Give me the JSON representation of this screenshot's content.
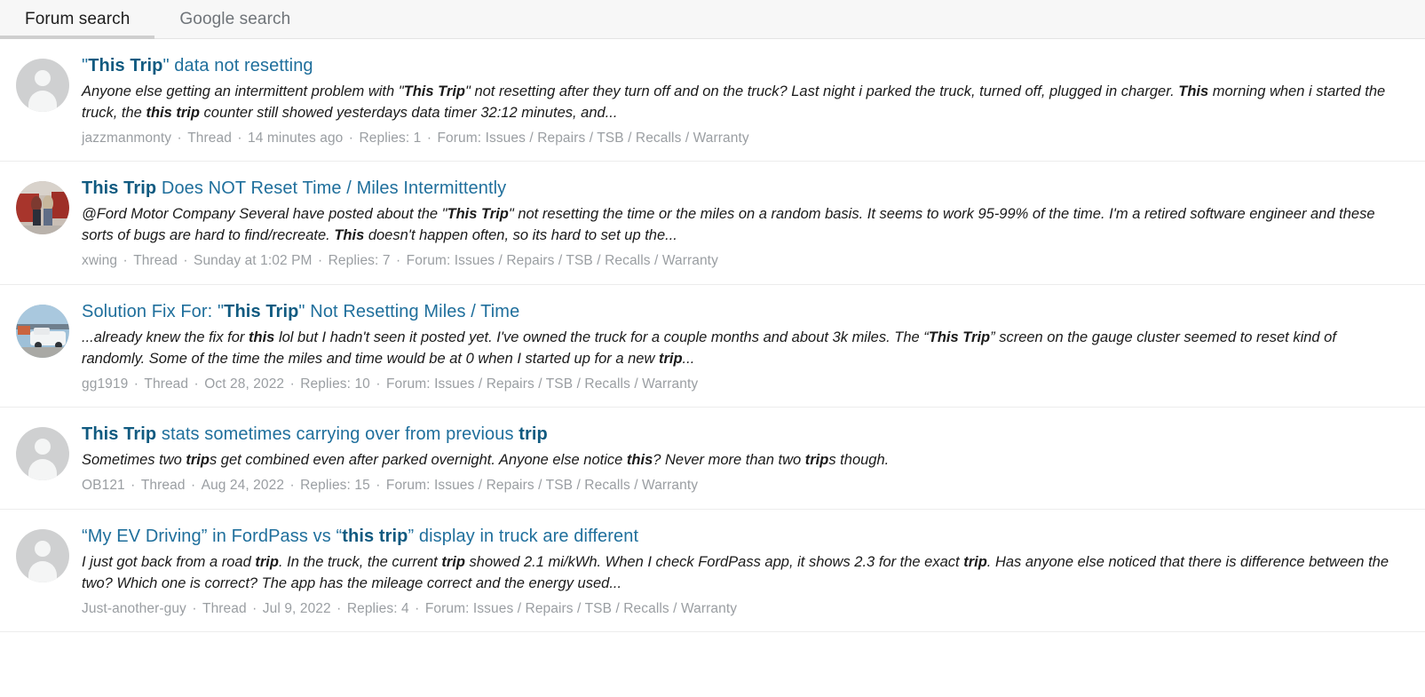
{
  "topbar": {
    "scrollbar": "vertical-scrollbar-thumb"
  },
  "tabs": [
    {
      "label": "Forum search",
      "active": true
    },
    {
      "label": "Google search",
      "active": false
    }
  ],
  "results": [
    {
      "avatar": "default-avatar-icon",
      "title_parts": [
        {
          "text": "\"",
          "bold": false
        },
        {
          "text": "This Trip",
          "bold": true
        },
        {
          "text": "\" data not resetting",
          "bold": false
        }
      ],
      "snippet_parts": [
        {
          "text": "Anyone else getting an intermittent problem with  \"",
          "bold": false
        },
        {
          "text": "This Trip",
          "bold": true
        },
        {
          "text": "\" not resetting after they turn off and on the truck? Last night i parked the truck, turned off, plugged in charger. ",
          "bold": false
        },
        {
          "text": "This",
          "bold": true
        },
        {
          "text": " morning when i started the truck, the ",
          "bold": false
        },
        {
          "text": "this trip",
          "bold": true
        },
        {
          "text": " counter still showed yesterdays data timer 32:12 minutes, and...",
          "bold": false
        }
      ],
      "author": "jazzmanmonty",
      "type": "Thread",
      "date": "14 minutes ago",
      "replies": "Replies: 1",
      "forum": "Forum: Issues / Repairs / TSB / Recalls / Warranty"
    },
    {
      "avatar": "user-photo-avatar",
      "title_parts": [
        {
          "text": "This Trip",
          "bold": true
        },
        {
          "text": " Does NOT Reset Time / Miles Intermittently",
          "bold": false
        }
      ],
      "snippet_parts": [
        {
          "text": "@Ford Motor Company Several have posted about the  \"",
          "bold": false
        },
        {
          "text": "This Trip",
          "bold": true
        },
        {
          "text": "\" not resetting the time or the miles on a random basis. It seems to work 95-99% of the time. I'm a retired software engineer and these sorts of bugs are hard to find/recreate. ",
          "bold": false
        },
        {
          "text": "This",
          "bold": true
        },
        {
          "text": " doesn't happen often, so its hard to set up the...",
          "bold": false
        }
      ],
      "author": "xwing",
      "type": "Thread",
      "date": "Sunday at 1:02 PM",
      "replies": "Replies: 7",
      "forum": "Forum: Issues / Repairs / TSB / Recalls / Warranty"
    },
    {
      "avatar": "user-photo-avatar",
      "title_parts": [
        {
          "text": "Solution Fix For: \"",
          "bold": false
        },
        {
          "text": "This Trip",
          "bold": true
        },
        {
          "text": "\" Not Resetting Miles / Time",
          "bold": false
        }
      ],
      "snippet_parts": [
        {
          "text": "...already knew the fix for ",
          "bold": false
        },
        {
          "text": "this",
          "bold": true
        },
        {
          "text": " lol but I hadn't seen it posted yet. I've owned the truck for a couple months and about 3k miles. The “",
          "bold": false
        },
        {
          "text": "This Trip",
          "bold": true
        },
        {
          "text": "” screen on the gauge cluster seemed to reset kind of randomly. Some of the time the miles and time would be at 0 when I started up for a new ",
          "bold": false
        },
        {
          "text": "trip",
          "bold": true
        },
        {
          "text": "...",
          "bold": false
        }
      ],
      "author": "gg1919",
      "type": "Thread",
      "date": "Oct 28, 2022",
      "replies": "Replies: 10",
      "forum": "Forum: Issues / Repairs / TSB / Recalls / Warranty"
    },
    {
      "avatar": "default-avatar-icon",
      "title_parts": [
        {
          "text": "This Trip",
          "bold": true
        },
        {
          "text": " stats sometimes carrying over from previous ",
          "bold": false
        },
        {
          "text": "trip",
          "bold": true
        }
      ],
      "snippet_parts": [
        {
          "text": "Sometimes two ",
          "bold": false
        },
        {
          "text": "trip",
          "bold": true
        },
        {
          "text": "s get combined even after parked overnight. Anyone else notice ",
          "bold": false
        },
        {
          "text": "this",
          "bold": true
        },
        {
          "text": "? Never more than two ",
          "bold": false
        },
        {
          "text": "trip",
          "bold": true
        },
        {
          "text": "s though.",
          "bold": false
        }
      ],
      "author": "OB121",
      "type": "Thread",
      "date": "Aug 24, 2022",
      "replies": "Replies: 15",
      "forum": "Forum: Issues / Repairs / TSB / Recalls / Warranty"
    },
    {
      "avatar": "default-avatar-icon",
      "title_parts": [
        {
          "text": "“My EV Driving” in FordPass vs “",
          "bold": false
        },
        {
          "text": "this trip",
          "bold": true
        },
        {
          "text": "” display in truck are different",
          "bold": false
        }
      ],
      "snippet_parts": [
        {
          "text": "I just got back from a road ",
          "bold": false
        },
        {
          "text": "trip",
          "bold": true
        },
        {
          "text": ". In the truck, the current ",
          "bold": false
        },
        {
          "text": "trip",
          "bold": true
        },
        {
          "text": " showed 2.1 mi/kWh. When I check FordPass app, it shows 2.3 for the exact ",
          "bold": false
        },
        {
          "text": "trip",
          "bold": true
        },
        {
          "text": ". Has anyone else noticed that there is difference between the two? Which one is correct? The app has the mileage correct and the energy used...",
          "bold": false
        }
      ],
      "author": "Just-another-guy",
      "type": "Thread",
      "date": "Jul 9, 2022",
      "replies": "Replies: 4",
      "forum": "Forum: Issues / Repairs / TSB / Recalls / Warranty"
    }
  ],
  "colors": {
    "link": "#1f6f9c",
    "link_bold": "#105a80",
    "meta": "#9a9ea2",
    "tab_active": "#1d1d1d",
    "tab_inactive": "#6f7479",
    "tab_underline": "#cfcfcf",
    "divider": "#ececec",
    "tabstrip_bg": "#f7f7f7",
    "avatar_bg": "#cfd0d1"
  }
}
